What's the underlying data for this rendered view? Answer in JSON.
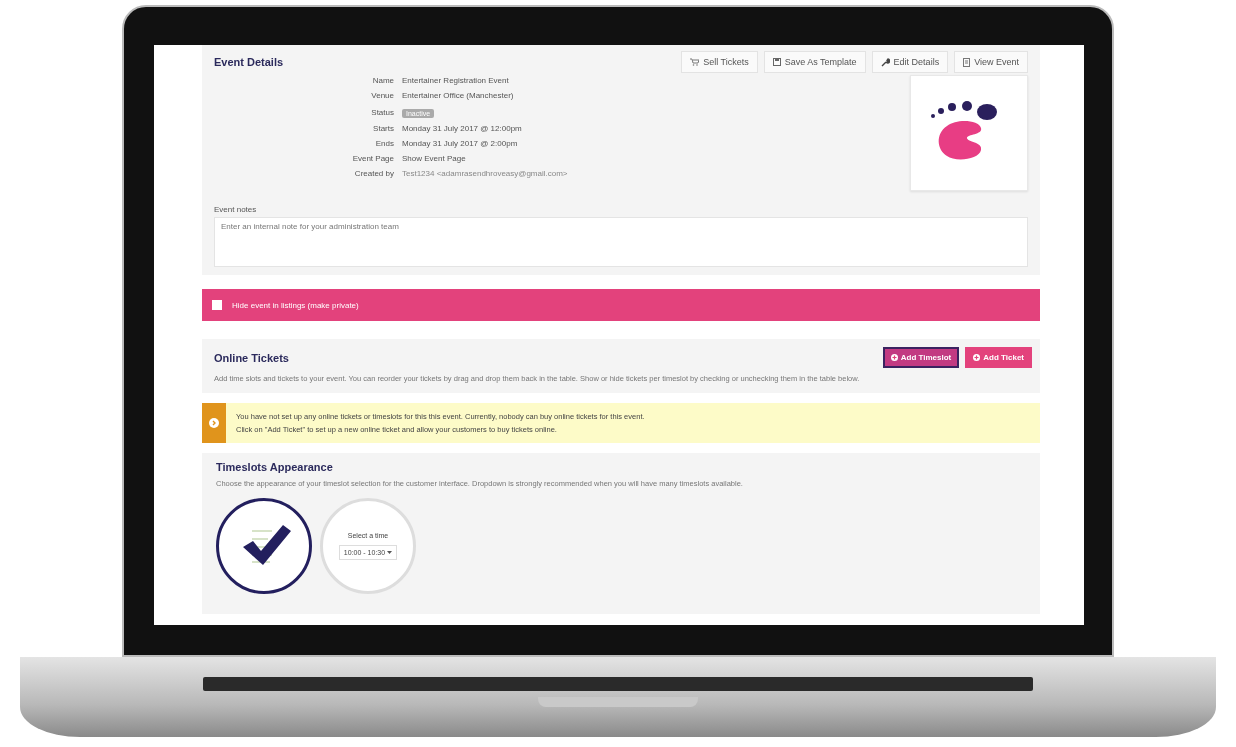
{
  "event_details": {
    "title": "Event Details",
    "buttons": [
      {
        "label": "Sell Tickets"
      },
      {
        "label": "Save As Template"
      },
      {
        "label": "Edit Details"
      },
      {
        "label": "View Event"
      }
    ],
    "fields": [
      {
        "label": "Name",
        "value": "Entertainer Registration Event",
        "kind": "text"
      },
      {
        "label": "Venue",
        "value": "Entertainer Office (Manchester)",
        "kind": "text"
      },
      {
        "label": "Status",
        "value": "Inactive",
        "kind": "badge"
      },
      {
        "label": "Starts",
        "value": "Monday 31 July 2017 @ 12:00pm",
        "kind": "text"
      },
      {
        "label": "Ends",
        "value": "Monday 31 July 2017 @ 2:00pm",
        "kind": "text"
      },
      {
        "label": "Event Page",
        "value": "Show Event Page",
        "kind": "text"
      },
      {
        "label": "Created by",
        "value": "Test1234 <adamrasendhroveasy@gmail.com>",
        "kind": "muted"
      }
    ],
    "notes": {
      "label": "Event notes",
      "placeholder": "Enter an internal note for your administration team"
    }
  },
  "private_bar": {
    "label": "Hide event in listings (make private)",
    "checked": false
  },
  "online_tickets": {
    "title": "Online Tickets",
    "description": "Add time slots and tickets to your event. You can reorder your tickets by drag and drop them back in the table. Show or hide tickets per timeslot by checking or unchecking them in the table below.",
    "buttons": [
      {
        "label": "Add Timeslot",
        "selected": true
      },
      {
        "label": "Add Ticket",
        "selected": false
      }
    ]
  },
  "warning": {
    "lines": [
      "You have not set up any online tickets or timeslots for this this event. Currently, nobody can buy online tickets for this event.",
      "Click on \"Add Ticket\" to set up a new online ticket and allow your customers to buy tickets online."
    ]
  },
  "timeslots": {
    "title": "Timeslots Appearance",
    "description": "Choose the appearance of your timeslot selection for the customer interface. Dropdown is strongly recommended when you will have many timeslots available.",
    "options": [
      {
        "kind": "list",
        "selected": true
      },
      {
        "kind": "dropdown",
        "selected": false,
        "heading": "Select a time",
        "value": "10:00 - 10:30"
      }
    ]
  }
}
